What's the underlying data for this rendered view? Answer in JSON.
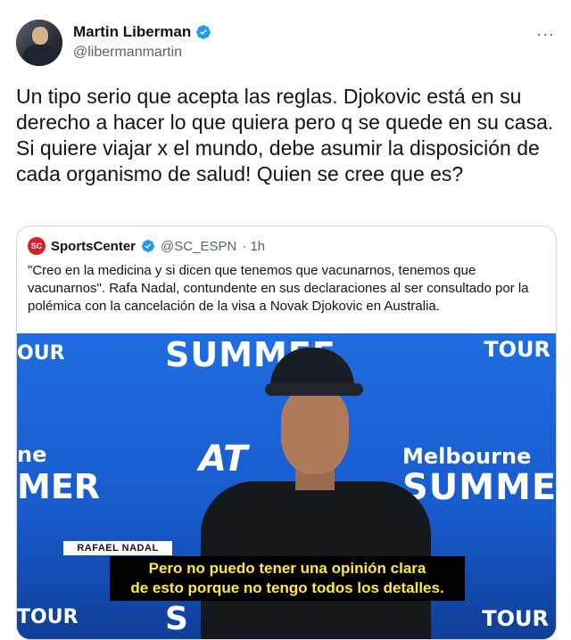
{
  "author": {
    "name": "Martin Liberman",
    "handle": "@libermanmartin",
    "verified": true
  },
  "tweet": {
    "text": "Un tipo serio que acepta las reglas. Djokovic está en su derecho a hacer lo que quiera pero q se quede en su casa. Si quiere viajar x el mundo, debe asumir la disposición de cada organismo de salud! Quien se cree que es?"
  },
  "more_label": "···",
  "quote": {
    "logo_text": "SC",
    "name": "SportsCenter",
    "handle": "@SC_ESPN",
    "time": "· 1h",
    "text": "\"Creo en la medicina y si dicen que tenemos que vacunarnos, tenemos que vacunarnos\". Rafa Nadal, contundente en sus declaraciones al ser consultado por la polémica con la cancelación de la visa a Novak Djokovic en Australia."
  },
  "media": {
    "backdrop": {
      "summer_top": "SUMMEF",
      "tour_top_left": "OUR",
      "tour_top_right": "TOUR",
      "ne_left": "ne",
      "mer_left": "MER",
      "melbourne": "Melbourne",
      "summer_right": "SUMMER",
      "atp": "AT",
      "tour_bottom_left": "TOUR",
      "tour_bottom_right": "TOUR",
      "sc_bottom": "S"
    },
    "name_tag": "RAFAEL NADAL",
    "subtitle_line1": "Pero no puedo tener una opinión clara",
    "subtitle_line2": "de esto porque no tengo todos los detalles."
  },
  "colors": {
    "verified": "#1d9bf0",
    "text_secondary": "#536471",
    "border": "#cfd9de",
    "subtitle_text": "#ffea3a",
    "backdrop_blue": "#1b5fd0"
  },
  "icons": {
    "verified": "verified-badge-icon",
    "more": "more-options-icon"
  }
}
